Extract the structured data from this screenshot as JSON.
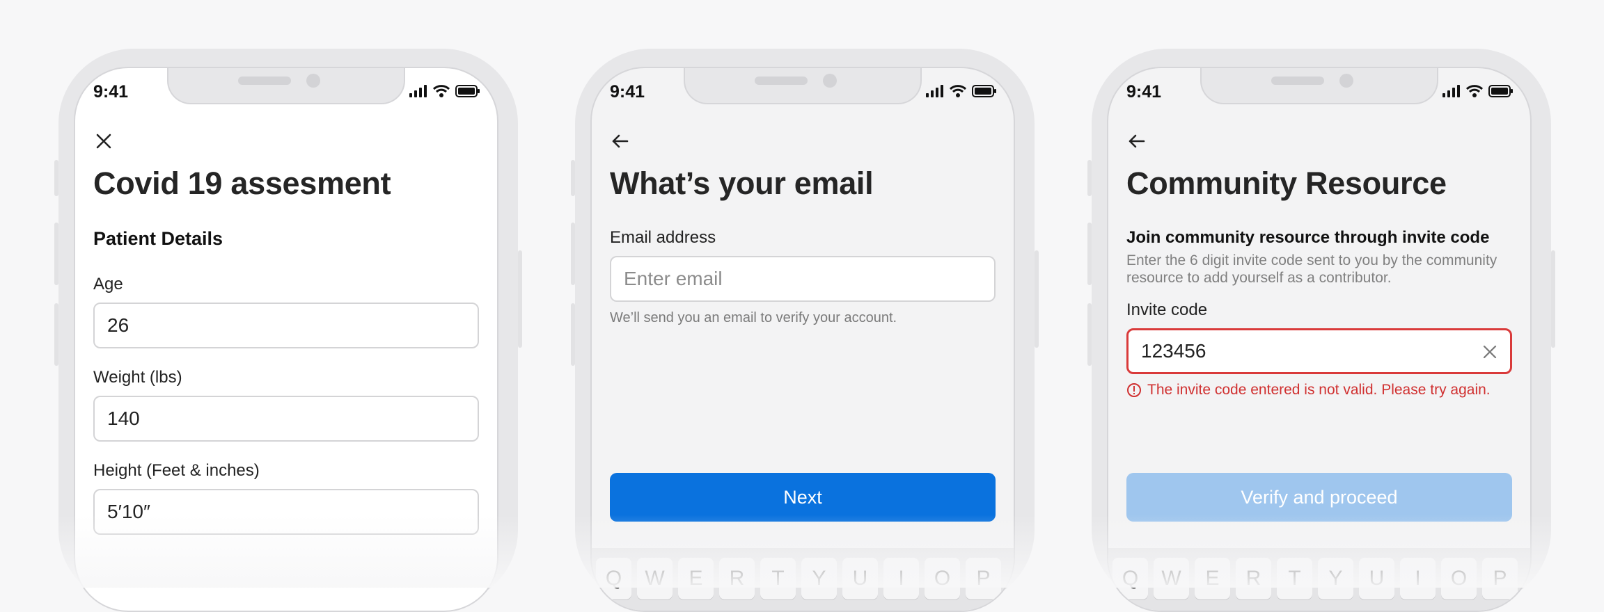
{
  "colors": {
    "primary": "#0A72DE",
    "primary_disabled": "#9FC6EE",
    "error": "#D03030",
    "background": "#F7F7F8"
  },
  "phones": [
    {
      "time": "9:41",
      "nav_icon": "close-icon",
      "title": "Covid 19 assesment",
      "section": "Patient Details",
      "fields": [
        {
          "label": "Age",
          "value": "26"
        },
        {
          "label": "Weight (lbs)",
          "value": "140"
        },
        {
          "label": "Height (Feet & inches)",
          "value": "5′10″"
        }
      ]
    },
    {
      "time": "9:41",
      "nav_icon": "back-arrow-icon",
      "title": "What’s your email",
      "field_label": "Email address",
      "field_placeholder": "Enter email",
      "helper": "We’ll send you an email to verify your account.",
      "button": "Next",
      "keys": [
        "Q",
        "W",
        "E",
        "R",
        "T",
        "Y",
        "U",
        "I",
        "O",
        "P"
      ]
    },
    {
      "time": "9:41",
      "nav_icon": "back-arrow-icon",
      "title": "Community Resource",
      "section": "Join community resource through invite code",
      "description": "Enter the 6 digit invite code sent to you by the community resource to add yourself as a contributor.",
      "field_label": "Invite code",
      "field_value": "123456",
      "error": "The invite code entered is not valid. Please try again.",
      "button": "Verify and proceed",
      "keys": [
        "Q",
        "W",
        "E",
        "R",
        "T",
        "Y",
        "U",
        "I",
        "O",
        "P"
      ]
    }
  ]
}
